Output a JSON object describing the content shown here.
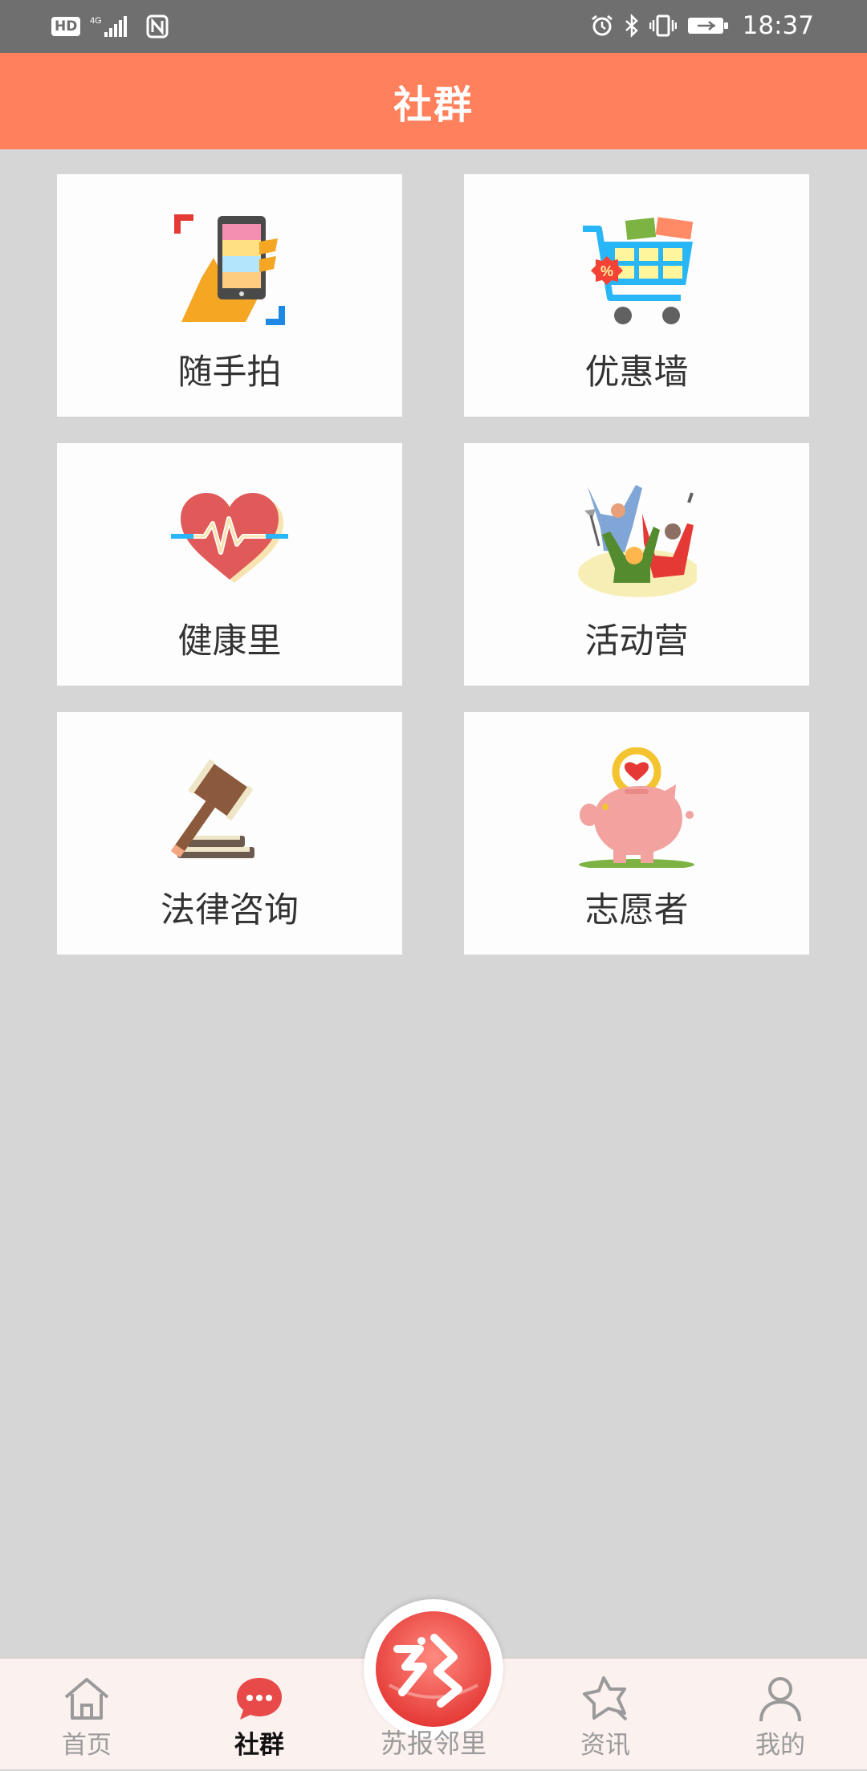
{
  "status_bar": {
    "hd": "HD",
    "network": "4G",
    "time": "18:37",
    "icons": [
      "hd-icon",
      "signal-icon",
      "nfc-icon",
      "alarm-icon",
      "bluetooth-icon",
      "vibrate-icon",
      "battery-icon"
    ]
  },
  "header": {
    "title": "社群"
  },
  "grid": {
    "items": [
      {
        "label": "随手拍",
        "icon": "hand-phone-icon"
      },
      {
        "label": "优惠墙",
        "icon": "shopping-cart-icon"
      },
      {
        "label": "健康里",
        "icon": "heart-pulse-icon"
      },
      {
        "label": "活动营",
        "icon": "people-cheering-icon"
      },
      {
        "label": "法律咨询",
        "icon": "gavel-icon"
      },
      {
        "label": "志愿者",
        "icon": "piggy-bank-icon"
      }
    ]
  },
  "bottom_nav": {
    "items": [
      {
        "label": "首页",
        "icon": "home-icon",
        "active": false
      },
      {
        "label": "社群",
        "icon": "chat-icon",
        "active": true
      },
      {
        "label": "苏报邻里",
        "icon": "brand-logo-icon",
        "active": false
      },
      {
        "label": "资讯",
        "icon": "star-icon",
        "active": false
      },
      {
        "label": "我的",
        "icon": "user-icon",
        "active": false
      }
    ]
  },
  "colors": {
    "header": "#ff805c",
    "background": "#d6d6d6",
    "tile": "#fdfdfd",
    "nav_background": "#fbf1ee",
    "active_accent": "#e84a4a"
  }
}
